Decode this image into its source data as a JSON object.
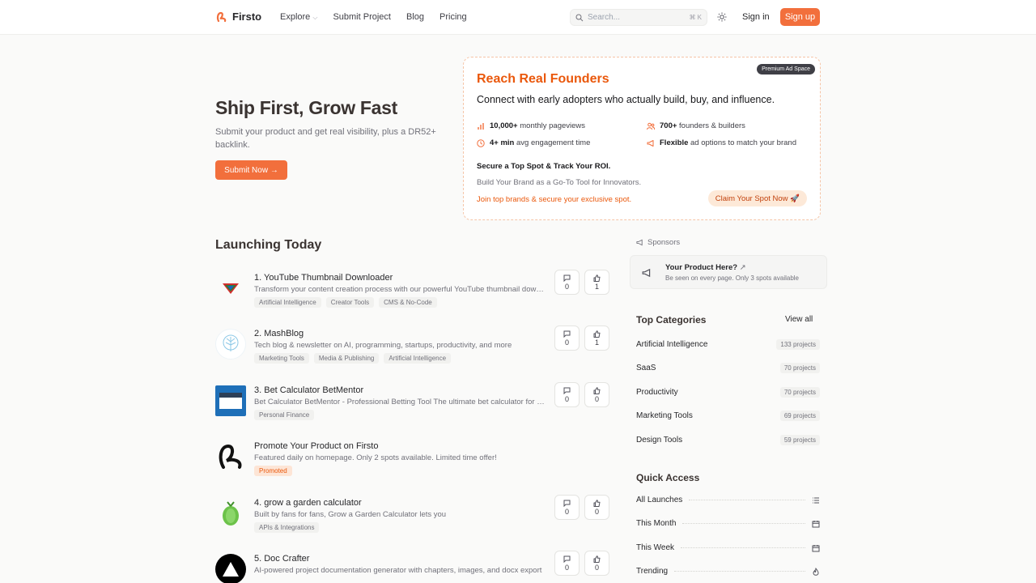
{
  "header": {
    "brand": "Firsto",
    "nav": [
      "Explore",
      "Submit Project",
      "Blog",
      "Pricing"
    ],
    "search_placeholder": "Search...",
    "search_shortcut": "⌘ K",
    "signin": "Sign in",
    "signup": "Sign up"
  },
  "hero": {
    "title": "Ship First, Grow Fast",
    "subtitle": "Submit your product and get real visibility, plus a DR52+ backlink.",
    "cta": "Submit Now →"
  },
  "ad": {
    "badge": "Premium Ad Space",
    "title": "Reach Real Founders",
    "subtitle": "Connect with early adopters who actually build, buy, and influence.",
    "stats": [
      {
        "bold": "10,000+",
        "text": " monthly pageviews",
        "icon": "bar-chart-icon"
      },
      {
        "bold": "700+",
        "text": " founders & builders",
        "icon": "users-icon"
      },
      {
        "bold": "4+ min",
        "text": " avg engagement time",
        "icon": "clock-icon"
      },
      {
        "bold": "Flexible",
        "text": " ad options to match your brand",
        "icon": "megaphone-icon"
      }
    ],
    "secure": "Secure a Top Spot & Track Your ROI.",
    "build": "Build Your Brand as a Go-To Tool for Innovators.",
    "join": "Join top brands & secure your exclusive spot.",
    "claim": "Claim Your Spot Now 🚀"
  },
  "launching": {
    "title": "Launching Today",
    "items": [
      {
        "name": "1. YouTube Thumbnail Downloader",
        "desc": "Transform your content creation process with our powerful YouTube thumbnail downloader",
        "tags": [
          "Artificial Intelligence",
          "Creator Tools",
          "CMS & No-Code"
        ],
        "comments": "0",
        "votes": "1"
      },
      {
        "name": "2. MashBlog",
        "desc": "Tech blog & newsletter on AI, programming, startups, productivity, and more",
        "tags": [
          "Marketing Tools",
          "Media & Publishing",
          "Artificial Intelligence"
        ],
        "comments": "0",
        "votes": "1"
      },
      {
        "name": "3. Bet Calculator BetMentor",
        "desc": "Bet Calculator BetMentor - Professional Betting Tool The ultimate bet calculator for bettors",
        "tags": [
          "Personal Finance"
        ],
        "comments": "0",
        "votes": "0"
      },
      {
        "name": "Promote Your Product on Firsto",
        "desc": "Featured daily on homepage. Only 2 spots available. Limited time offer!",
        "tags": [
          "Promoted"
        ]
      },
      {
        "name": "4. grow a garden calculator",
        "desc": "Built by fans for fans, Grow a Garden Calculator lets you",
        "tags": [
          "APIs & Integrations"
        ],
        "comments": "0",
        "votes": "0"
      },
      {
        "name": "5. Doc Crafter",
        "desc": "AI-powered project documentation generator with chapters, images, and docx export",
        "tags": [],
        "comments": "0",
        "votes": "0"
      }
    ]
  },
  "sponsors": {
    "label": "Sponsors",
    "title": "Your Product Here?",
    "subtitle": "Be seen on every page. Only 3 spots available"
  },
  "categories": {
    "title": "Top Categories",
    "view_all": "View all",
    "items": [
      {
        "name": "Artificial Intelligence",
        "count": "133 projects"
      },
      {
        "name": "SaaS",
        "count": "70 projects"
      },
      {
        "name": "Productivity",
        "count": "70 projects"
      },
      {
        "name": "Marketing Tools",
        "count": "69 projects"
      },
      {
        "name": "Design Tools",
        "count": "59 projects"
      }
    ]
  },
  "quick_access": {
    "title": "Quick Access",
    "items": [
      {
        "name": "All Launches",
        "icon": "list-icon"
      },
      {
        "name": "This Month",
        "icon": "calendar-icon"
      },
      {
        "name": "This Week",
        "icon": "calendar-icon"
      },
      {
        "name": "Trending",
        "icon": "flame-icon"
      }
    ]
  }
}
